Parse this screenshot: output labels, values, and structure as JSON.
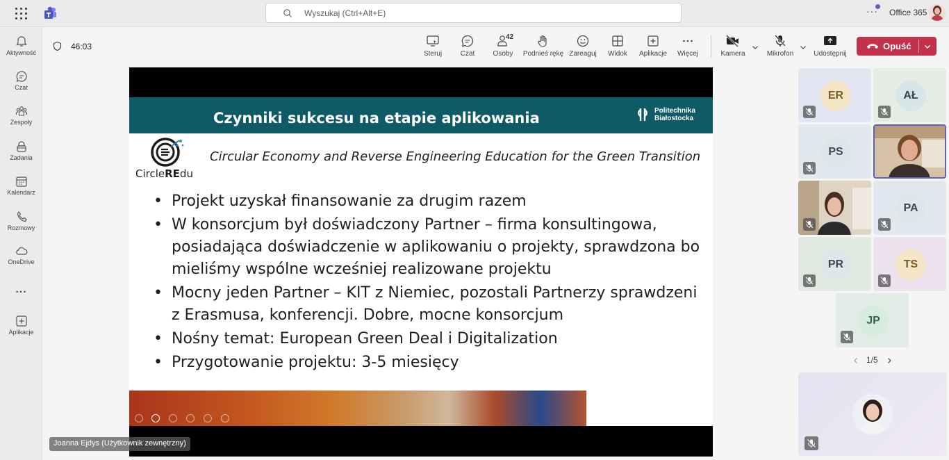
{
  "topbar": {
    "search_placeholder": "Wyszukaj (Ctrl+Alt+E)",
    "org_label": "Office 365"
  },
  "rail": {
    "items": [
      {
        "label": "Aktywność",
        "icon": "bell-icon"
      },
      {
        "label": "Czat",
        "icon": "chat-icon"
      },
      {
        "label": "Zespoły",
        "icon": "teams-icon"
      },
      {
        "label": "Zadania",
        "icon": "tasks-icon"
      },
      {
        "label": "Kalendarz",
        "icon": "calendar-icon"
      },
      {
        "label": "Rozmowy",
        "icon": "phone-icon"
      },
      {
        "label": "OneDrive",
        "icon": "cloud-icon"
      },
      {
        "label": "...",
        "icon": "more-icon"
      },
      {
        "label": "Aplikacje",
        "icon": "add-apps-icon"
      }
    ]
  },
  "meeting": {
    "timer": "46:03",
    "toolbar": {
      "control": "Steruj",
      "chat": "Czat",
      "people": "Osoby",
      "people_count": "42",
      "raise_hand": "Podnieś rękę",
      "react": "Zareaguj",
      "view": "Widok",
      "apps": "Aplikacje",
      "more": "Więcej",
      "camera": "Kamera",
      "mic": "Mikrofon",
      "share": "Udostępnij",
      "leave": "Opuść"
    }
  },
  "slide": {
    "title": "Czynniki sukcesu na etapie aplikowania",
    "university_line1": "Politechnika",
    "university_line2": "Białostocka",
    "logo_text_a": "Circle",
    "logo_text_b": "RE",
    "logo_text_c": "du",
    "subtitle": "Circular Economy and Reverse Engineering Education  for the Green Transition",
    "bullets": [
      "Projekt uzyskał finansowanie za drugim razem",
      "W konsorcjum był doświadczony Partner – firma konsultingowa, posiadająca doświadczenie w aplikowaniu o projekty, sprawdzona bo mieliśmy wspólne wcześniej realizowane projektu",
      "Mocny jeden Partner – KIT z Niemiec, pozostali Partnerzy sprawdzeni z Erasmusa, konferencji. Dobre, mocne  konsorcjum",
      "Nośny temat: European Green Deal i Digitalization",
      "Przygotowanie projektu: 3-5 miesięcy"
    ]
  },
  "presenter_name": "Joanna Ejdys (Użytkownik zewnętrzny)",
  "participants": [
    {
      "initials": "ER",
      "bg": "#f6e6c8",
      "fg": "#7a5a1e",
      "tile": "#e3e6f2"
    },
    {
      "initials": "AŁ",
      "bg": "#d8e6ea",
      "fg": "#2e4a55",
      "tile": "#e4ece4"
    },
    {
      "initials": "PS",
      "bg": "#dfe6ea",
      "fg": "#3a4a55",
      "tile": "#e2e9ee"
    },
    {
      "initials": "",
      "video": true,
      "tile": "#c9b39a"
    },
    {
      "initials": "",
      "video": true,
      "tile": "#d9d2c4"
    },
    {
      "initials": "PA",
      "bg": "#dfe6ea",
      "fg": "#3a4a55",
      "tile": "#e1e8ee"
    },
    {
      "initials": "PR",
      "bg": "#dfe6ea",
      "fg": "#3a4a55",
      "tile": "#e1eae2"
    },
    {
      "initials": "TS",
      "bg": "#f6e6c8",
      "fg": "#7a5a1e",
      "tile": "#ece3ee"
    },
    {
      "initials": "JP",
      "bg": "#d6ecdf",
      "fg": "#2e6a48",
      "tile": "#e1ece6"
    }
  ],
  "pager": "1/5"
}
